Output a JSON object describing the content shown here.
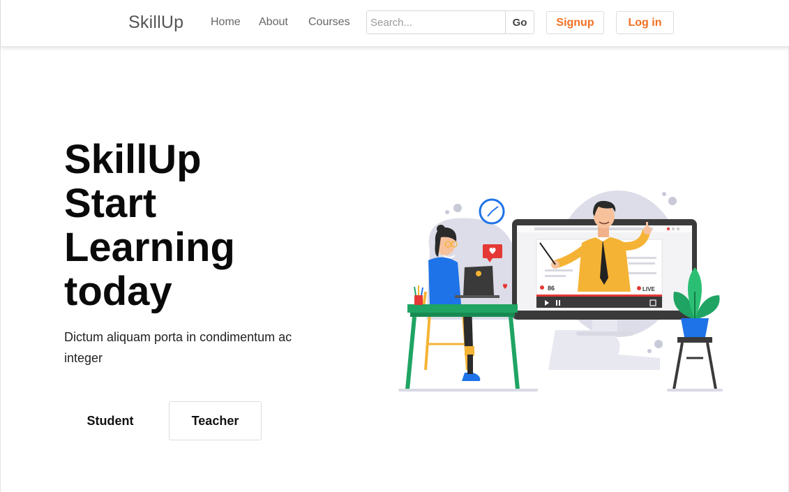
{
  "navbar": {
    "brand": "SkillUp",
    "links": [
      {
        "label": "Home"
      },
      {
        "label": "About"
      },
      {
        "label": "Courses"
      }
    ],
    "search": {
      "placeholder": "Search...",
      "value": "",
      "go_label": "Go"
    },
    "signup_label": "Signup",
    "login_label": "Log in"
  },
  "hero": {
    "title_lines": [
      "SkillUp",
      "Start",
      "Learning",
      "today"
    ],
    "subtitle": "Dictum aliquam porta in condimentum ac integer",
    "student_label": "Student",
    "teacher_label": "Teacher"
  },
  "illustration": {
    "viewers_count": "86",
    "live_label": "LIVE",
    "icon": "online-class-illustration"
  },
  "colors": {
    "accent": "#f26f21",
    "desk_green": "#1fa463",
    "shirt_yellow": "#f5b335",
    "shirt_blue": "#1e73e8",
    "monitor_dark": "#3a3a3a",
    "blob_lavender": "#dcdde8"
  }
}
